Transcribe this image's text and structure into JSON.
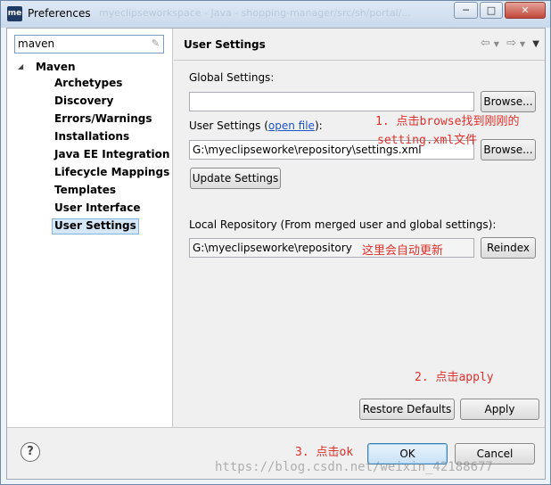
{
  "window": {
    "title": "Preferences",
    "icon_label": "me",
    "ghost_title": "myeclipseworkspace - Java - shopping-manager/src/sh/portal/...",
    "minimize_icon": "minimize-icon",
    "maximize_icon": "maximize-icon",
    "close_icon": "close-icon"
  },
  "filter": {
    "value": "maven"
  },
  "tree": {
    "root": "Maven",
    "items": [
      "Archetypes",
      "Discovery",
      "Errors/Warnings",
      "Installations",
      "Java EE Integration",
      "Lifecycle Mappings",
      "Templates",
      "User Interface",
      "User Settings"
    ],
    "selected": "User Settings"
  },
  "page": {
    "title": "User Settings",
    "global_settings_label": "Global Settings:",
    "global_settings_value": "",
    "browse_label": "Browse...",
    "user_settings_label": "User Settings (",
    "open_file_link": "open file",
    "user_settings_label_end": "):",
    "user_settings_value": "G:\\myeclipseworke\\repository\\settings.xml",
    "update_settings_label": "Update Settings",
    "local_repo_label": "Local Repository (From merged user and global settings):",
    "local_repo_value": "G:\\myeclipseworke\\repository",
    "reindex_label": "Reindex",
    "restore_defaults_label": "Restore Defaults",
    "apply_label": "Apply"
  },
  "annotations": {
    "step1_line1": "1. 点击browse找到刚刚的",
    "step1_line2": "setting.xml文件",
    "auto_update": "这里会自动更新",
    "step2": "2. 点击apply",
    "step3": "3. 点击ok"
  },
  "dialog": {
    "help_label": "?",
    "ok_label": "OK",
    "cancel_label": "Cancel"
  },
  "watermark": "https://blog.csdn.net/weixin_42188677",
  "colors": {
    "annotation": "#e0302a",
    "link": "#1a55c7",
    "selection": "#d5e6f7"
  }
}
